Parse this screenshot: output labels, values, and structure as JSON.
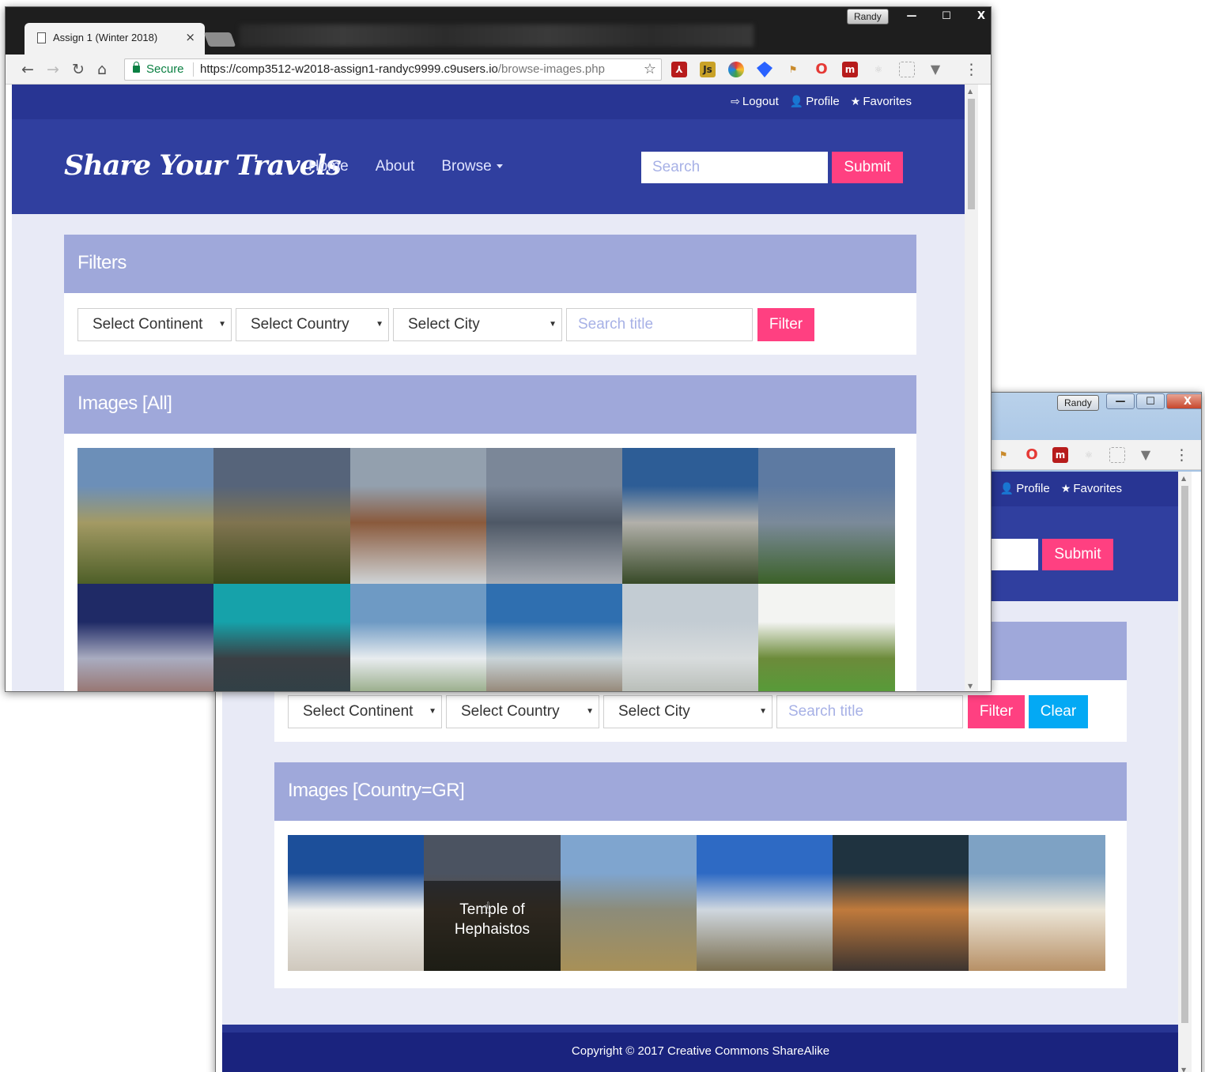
{
  "browser": {
    "tab_title": "Assign 1 (Winter 2018)",
    "tab_close": "×",
    "user": "Randy",
    "secure_label": "Secure",
    "url_host": "https://comp3512-w2018-assign1-randyc9999.c9users.io",
    "url_path": "/browse-images.php",
    "window_buttons": [
      "—",
      "☐",
      "X"
    ]
  },
  "site": {
    "brand": "Share Your Travels",
    "top_links": [
      {
        "icon": "logout-icon",
        "glyph": "⇨",
        "label": "Logout"
      },
      {
        "icon": "user-icon",
        "glyph": "👤",
        "label": "Profile"
      },
      {
        "icon": "star-icon",
        "glyph": "★",
        "label": "Favorites"
      }
    ],
    "nav": [
      "Home",
      "About",
      "Browse"
    ],
    "search_placeholder": "Search",
    "submit_label": "Submit",
    "footer": "Copyright © 2017 Creative Commons ShareAlike"
  },
  "filters": {
    "heading": "Filters",
    "continent": "Select Continent",
    "country": "Select Country",
    "city": "Select City",
    "title_placeholder": "Search title",
    "filter_label": "Filter",
    "clear_label": "Clear"
  },
  "front_window": {
    "images_heading": "Images [All]",
    "images": [
      {
        "colors": [
          "#6c8fb8",
          "#a39a64",
          "#4e5f28"
        ]
      },
      {
        "colors": [
          "#56647a",
          "#807450",
          "#3c4a1c"
        ]
      },
      {
        "colors": [
          "#93a0ae",
          "#8a5a3c",
          "#cfd3d6"
        ]
      },
      {
        "colors": [
          "#7b8798",
          "#4e5866",
          "#a9adb4"
        ]
      },
      {
        "colors": [
          "#2d5d96",
          "#b2b0aa",
          "#384a28"
        ]
      },
      {
        "colors": [
          "#5d7aa2",
          "#7b8a9a",
          "#3b6128"
        ]
      },
      {
        "colors": [
          "#1f2a66",
          "#a9acc0",
          "#8a4a32"
        ]
      },
      {
        "colors": [
          "#16a2aa",
          "#3a3f44",
          "#2a4047"
        ]
      },
      {
        "colors": [
          "#6e9ac4",
          "#e8ecef",
          "#5a7b3a"
        ]
      },
      {
        "colors": [
          "#2f6fb0",
          "#c9d4d8",
          "#6b4a2a"
        ]
      },
      {
        "colors": [
          "#c3ccd3",
          "#d8dcdd",
          "#9fa59a"
        ]
      },
      {
        "colors": [
          "#f3f4f2",
          "#6c8b3a",
          "#46a838"
        ]
      }
    ]
  },
  "back_window": {
    "images_heading": "Images [Country=GR]",
    "hover_caption": "Temple of Hephaistos",
    "images": [
      {
        "colors": [
          "#1c4f9a",
          "#f2f2ef",
          "#cfc8bd"
        ]
      },
      {
        "colors": [
          "#4b5361",
          "#5a4e3e",
          "#3a3a2a"
        ]
      },
      {
        "colors": [
          "#7fa5cf",
          "#8c8c7a",
          "#a89057"
        ]
      },
      {
        "colors": [
          "#2e6ac4",
          "#cfd7df",
          "#7a6e4e"
        ]
      },
      {
        "colors": [
          "#1f3340",
          "#c07a3c",
          "#3c3430"
        ]
      },
      {
        "colors": [
          "#7ea2c4",
          "#ece6d8",
          "#b79066"
        ]
      }
    ]
  }
}
